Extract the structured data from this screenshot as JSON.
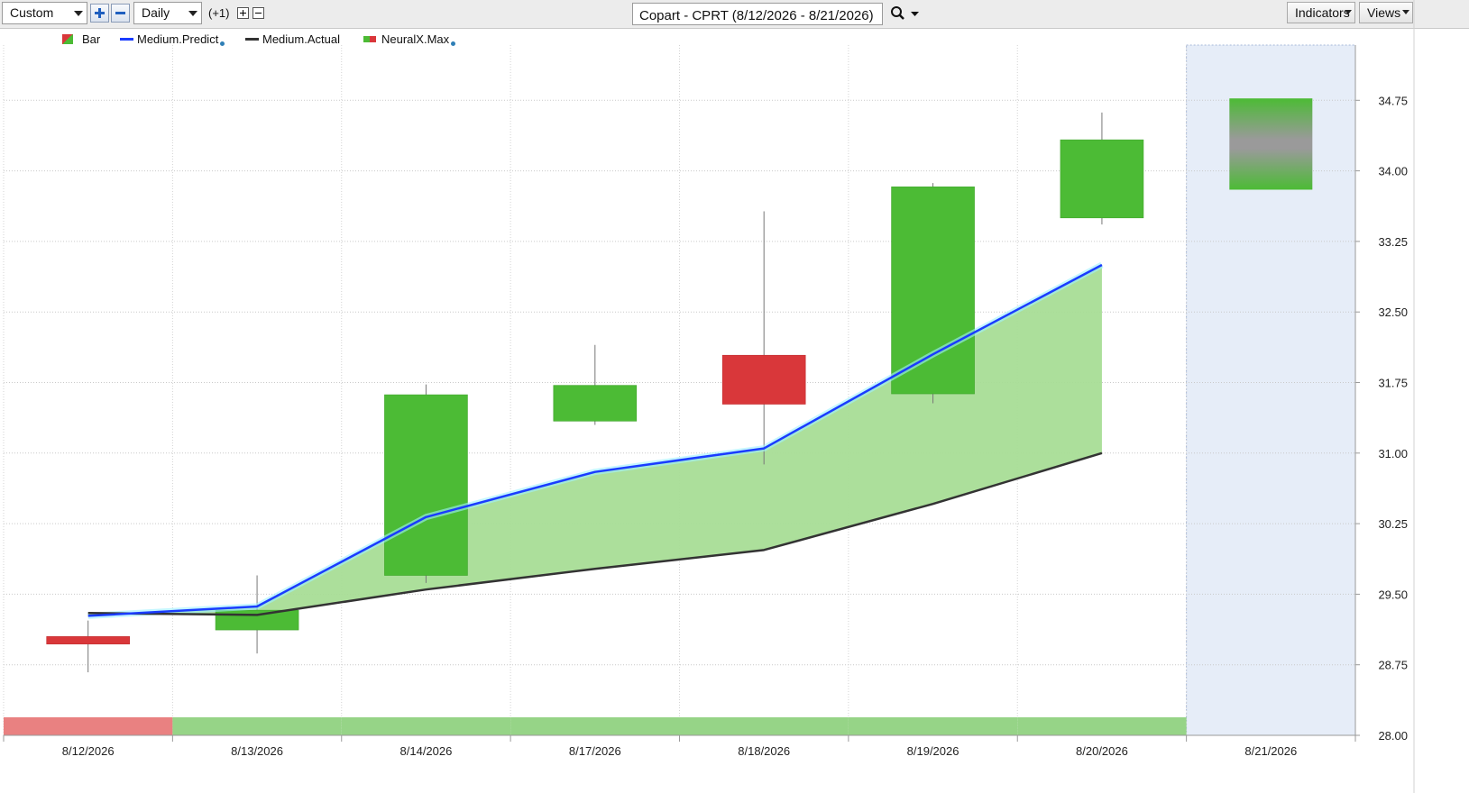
{
  "toolbar": {
    "range_select": "Custom",
    "period_select": "Daily",
    "offset_label": "(+1)",
    "symbol_title": "Copart - CPRT (8/12/2026 - 8/21/2026)",
    "indicators_label": "Indicators",
    "views_label": "Views"
  },
  "legend": [
    {
      "label": "Bar",
      "icon": "bar-swatch"
    },
    {
      "label": "Medium.Predict",
      "icon": "blue-line"
    },
    {
      "label": "Medium.Actual",
      "icon": "dark-line"
    },
    {
      "label": "NeuralX.Max",
      "icon": "neural-swatch"
    }
  ],
  "colors": {
    "up": "#4cbb35",
    "down": "#d9373a",
    "predict_line": "#1a3cff",
    "actual_line": "#333333",
    "band_fill": "#a8dd96",
    "forecast_shade": "#e6edf8",
    "forecast_bar": "#9a9a9a",
    "strip_down": "#e98181",
    "strip_up": "#96d487"
  },
  "chart_data": {
    "type": "candlestick",
    "title": "Copart - CPRT (8/12/2026 - 8/21/2026)",
    "categories": [
      "8/12/2026",
      "8/13/2026",
      "8/14/2026",
      "8/17/2026",
      "8/18/2026",
      "8/19/2026",
      "8/20/2026",
      "8/21/2026"
    ],
    "y_ticks": [
      "34.75",
      "34.00",
      "33.25",
      "32.50",
      "31.75",
      "31.00",
      "30.25",
      "29.50",
      "28.75",
      "28.00"
    ],
    "ylim": [
      28.0,
      35.5
    ],
    "grid": true,
    "legend_position": "top-left",
    "candles": [
      {
        "date": "8/12/2026",
        "open": 29.05,
        "high": 29.22,
        "low": 28.67,
        "close": 28.97,
        "color": "down"
      },
      {
        "date": "8/13/2026",
        "open": 29.12,
        "high": 29.7,
        "low": 28.87,
        "close": 29.33,
        "color": "up"
      },
      {
        "date": "8/14/2026",
        "open": 29.7,
        "high": 31.73,
        "low": 29.62,
        "close": 31.62,
        "color": "up"
      },
      {
        "date": "8/17/2026",
        "open": 31.34,
        "high": 32.15,
        "low": 31.3,
        "close": 31.72,
        "color": "up"
      },
      {
        "date": "8/18/2026",
        "open": 32.04,
        "high": 33.57,
        "low": 30.88,
        "close": 31.52,
        "color": "down"
      },
      {
        "date": "8/19/2026",
        "open": 31.63,
        "high": 33.87,
        "low": 31.53,
        "close": 33.83,
        "color": "up"
      },
      {
        "date": "8/20/2026",
        "open": 33.5,
        "high": 34.62,
        "low": 33.43,
        "close": 34.33,
        "color": "up"
      }
    ],
    "forecast": {
      "date": "8/21/2026",
      "high": 34.77,
      "low": 33.8
    },
    "series": [
      {
        "name": "Medium.Predict",
        "values": [
          29.27,
          29.37,
          30.32,
          30.8,
          31.05,
          32.05,
          33.0
        ]
      },
      {
        "name": "Medium.Actual",
        "values": [
          29.3,
          29.28,
          29.55,
          29.77,
          29.97,
          30.46,
          31.0
        ]
      }
    ],
    "neuralx_strip": [
      "down",
      "up",
      "up",
      "up",
      "up",
      "up",
      "up"
    ]
  }
}
